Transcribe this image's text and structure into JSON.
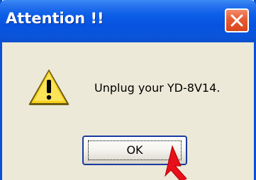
{
  "dialog": {
    "title": "Attention !!",
    "message": "Unplug your YD-8V14.",
    "ok_label": "OK",
    "icon": "warning-icon"
  },
  "titlebar": {
    "close_icon": "close-icon"
  },
  "colors": {
    "titlebar_blue": "#0753e0",
    "close_red": "#e65b33",
    "dialog_face": "#ece9d8",
    "warning_yellow": "#f7d21c",
    "arrow_red": "#e8101a"
  }
}
